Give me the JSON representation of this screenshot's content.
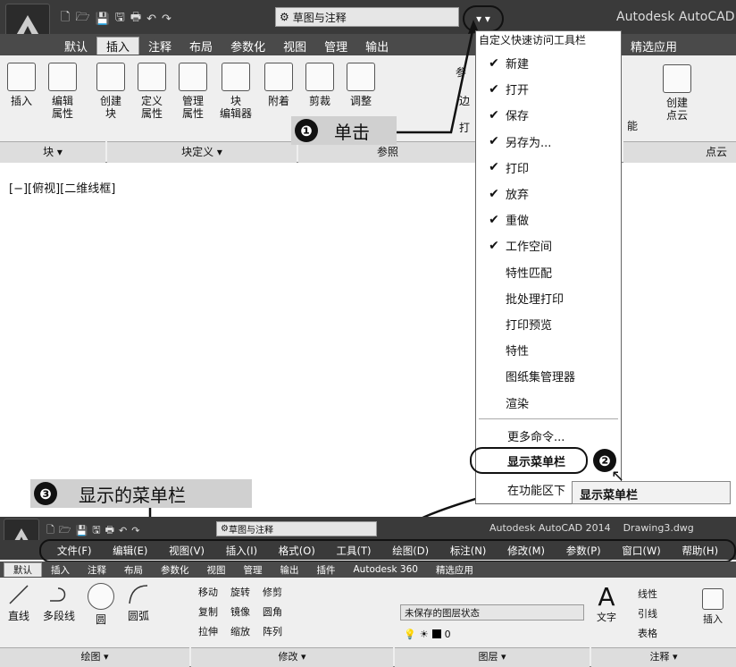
{
  "top": {
    "workspace": "草图与注释",
    "title": "Autodesk AutoCAD",
    "tabs": [
      "默认",
      "插入",
      "注释",
      "布局",
      "参数化",
      "视图",
      "管理",
      "输出"
    ],
    "extra_tab": "精选应用",
    "tools": [
      "插入",
      "编辑\n属性",
      "创建\n块",
      "定义\n属性",
      "管理\n属性",
      "块\n编辑器",
      "附着",
      "剪裁",
      "调整"
    ],
    "panel_block": "块 ▾",
    "panel_blockdef": "块定义 ▾",
    "panel_ref": "参照",
    "right_tool": "创建\n点云",
    "panel_pointcloud": "点云",
    "viewport": "[−][俯视][二维线框]",
    "partial_labels": {
      "can": "参",
      "bian": "边",
      "da": "打",
      "neng": "能"
    }
  },
  "menu": {
    "title": "自定义快速访问工具栏",
    "items": [
      {
        "label": "新建",
        "checked": true
      },
      {
        "label": "打开",
        "checked": true
      },
      {
        "label": "保存",
        "checked": true
      },
      {
        "label": "另存为...",
        "checked": true
      },
      {
        "label": "打印",
        "checked": true
      },
      {
        "label": "放弃",
        "checked": true
      },
      {
        "label": "重做",
        "checked": true
      },
      {
        "label": "工作空间",
        "checked": true
      },
      {
        "label": "特性匹配",
        "checked": false
      },
      {
        "label": "批处理打印",
        "checked": false
      },
      {
        "label": "打印预览",
        "checked": false
      },
      {
        "label": "特性",
        "checked": false
      },
      {
        "label": "图纸集管理器",
        "checked": false
      },
      {
        "label": "渲染",
        "checked": false
      }
    ],
    "more": "更多命令...",
    "show_menubar": "显示菜单栏",
    "below_ribbon": "在功能区下",
    "tooltip": "显示菜单栏"
  },
  "callouts": {
    "one_num": "❶",
    "one_text": "单击",
    "two_num": "❷",
    "three_num": "❸",
    "three_text": "显示的菜单栏"
  },
  "bottom": {
    "workspace": "草图与注释",
    "title": "Autodesk AutoCAD 2014    Drawing3.dwg",
    "menubar": [
      "文件(F)",
      "编辑(E)",
      "视图(V)",
      "插入(I)",
      "格式(O)",
      "工具(T)",
      "绘图(D)",
      "标注(N)",
      "修改(M)",
      "参数(P)",
      "窗口(W)",
      "帮助(H)"
    ],
    "tabs": [
      "默认",
      "插入",
      "注释",
      "布局",
      "参数化",
      "视图",
      "管理",
      "输出",
      "插件",
      "Autodesk 360",
      "精选应用"
    ],
    "draw_tools": [
      "直线",
      "多段线",
      "圆",
      "圆弧"
    ],
    "modify_tools": [
      [
        "移动",
        "旋转",
        "修剪"
      ],
      [
        "复制",
        "镜像",
        "圆角"
      ],
      [
        "拉伸",
        "缩放",
        "阵列"
      ]
    ],
    "layer_state": "未保存的图层状态",
    "layer_num": "0",
    "annot": [
      "文字",
      "线性",
      "引线",
      "表格"
    ],
    "insert": "插入",
    "panels": [
      "绘图 ▾",
      "修改 ▾",
      "图层 ▾",
      "注释 ▾"
    ]
  }
}
